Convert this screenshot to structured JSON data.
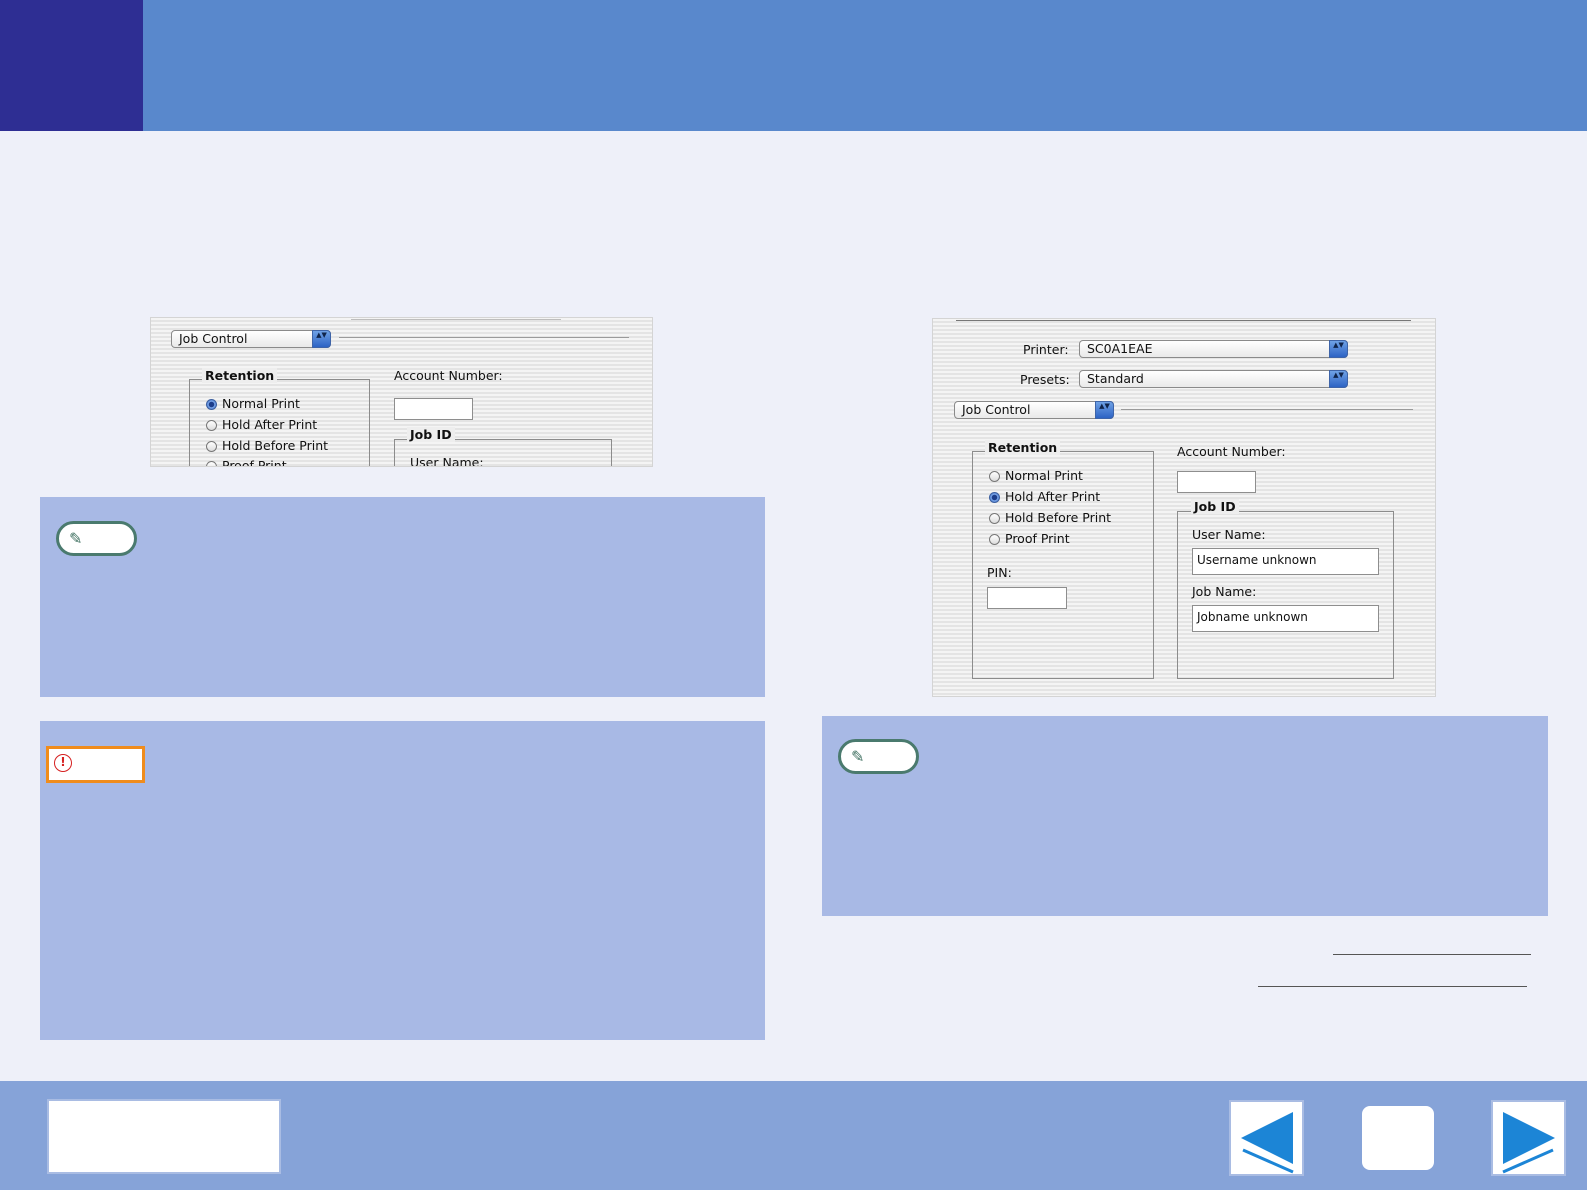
{
  "colors": {
    "header": "#5988cc",
    "header_tab": "#2e2e93",
    "background": "#eef0f9",
    "panel": "#a8b9e5",
    "footer": "#86a3d8",
    "note_border": "#4a7a6e",
    "warning_border": "#f08c1c",
    "nav_arrow": "#1c85d6"
  },
  "dialog_top": {
    "pane_menu": "Job Control",
    "retention_group": "Retention",
    "retention_options": [
      "Normal Print",
      "Hold After Print",
      "Hold Before Print",
      "Proof Print"
    ],
    "selected_option": "Normal Print",
    "account_number_label": "Account Number:",
    "job_id_group": "Job ID",
    "user_name_label": "User Name:"
  },
  "dialog_main": {
    "printer_label": "Printer:",
    "printer_value": "SC0A1EAE",
    "presets_label": "Presets:",
    "presets_value": "Standard",
    "pane_menu": "Job Control",
    "retention_group": "Retention",
    "retention_options": [
      "Normal Print",
      "Hold After Print",
      "Hold Before Print",
      "Proof Print"
    ],
    "selected_option": "Hold After Print",
    "pin_label": "PIN:",
    "account_number_label": "Account Number:",
    "job_id_group": "Job ID",
    "user_name_label": "User Name:",
    "user_name_value": "Username unknown",
    "job_name_label": "Job Name:",
    "job_name_value": "Jobname unknown"
  },
  "icons": {
    "note": "pencil-icon",
    "warning": "exclamation-icon",
    "prev": "arrow-left-icon",
    "next": "arrow-right-icon"
  },
  "glyphs": {
    "pencil": "✎",
    "exclamation": "!",
    "popup_arrows": "▲▼"
  }
}
